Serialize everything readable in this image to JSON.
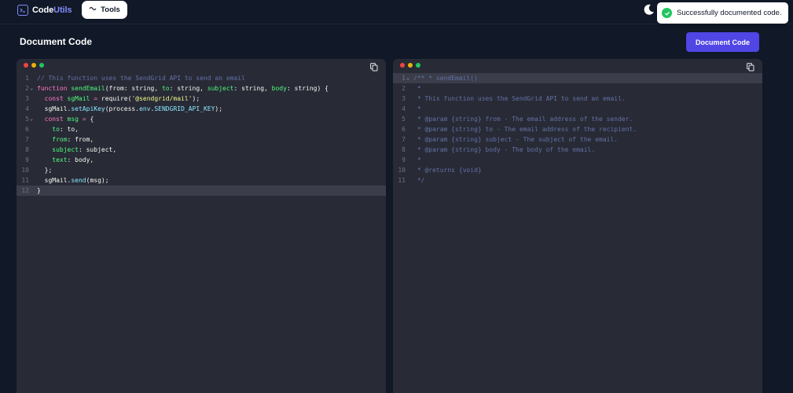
{
  "navbar": {
    "logo_code": "Code",
    "logo_utils": "Utils",
    "tools_label": "Tools"
  },
  "toast": {
    "message": "Successfully documented code."
  },
  "header": {
    "title": "Document Code",
    "action_label": "Document Code"
  },
  "colors": {
    "background": "#111827",
    "accent": "#4f46e5",
    "editor_bg": "#282a36",
    "success": "#22c55e"
  },
  "icons": [
    "logo-icon",
    "tools-icon",
    "moon-icon",
    "check-icon",
    "copy-icon"
  ],
  "input_editor": {
    "active_line": 12,
    "lines": [
      {
        "n": "1",
        "fold": false,
        "tokens": [
          {
            "t": "// This function uses the SendGrid API to send an email",
            "c": "t-comment"
          }
        ]
      },
      {
        "n": "2",
        "fold": true,
        "tokens": [
          {
            "t": "function",
            "c": "t-kw"
          },
          {
            "t": " ",
            "c": "t-plain"
          },
          {
            "t": "sendEmail",
            "c": "t-fn"
          },
          {
            "t": "(from: string, ",
            "c": "t-plain"
          },
          {
            "t": "to",
            "c": "t-fn"
          },
          {
            "t": ": string, ",
            "c": "t-plain"
          },
          {
            "t": "subject",
            "c": "t-fn"
          },
          {
            "t": ": string, ",
            "c": "t-plain"
          },
          {
            "t": "body",
            "c": "t-fn"
          },
          {
            "t": ": string) {",
            "c": "t-plain"
          }
        ]
      },
      {
        "n": "3",
        "fold": false,
        "tokens": [
          {
            "t": "  const",
            "c": "t-kw"
          },
          {
            "t": " ",
            "c": "t-plain"
          },
          {
            "t": "sgMail",
            "c": "t-fn"
          },
          {
            "t": " = ",
            "c": "t-kw"
          },
          {
            "t": "require",
            "c": "t-plain"
          },
          {
            "t": "(",
            "c": "t-plain"
          },
          {
            "t": "'@sendgrid/mail'",
            "c": "t-str"
          },
          {
            "t": ");",
            "c": "t-plain"
          }
        ]
      },
      {
        "n": "4",
        "fold": false,
        "tokens": [
          {
            "t": "  sgMail.",
            "c": "t-plain"
          },
          {
            "t": "setApiKey",
            "c": "t-prop"
          },
          {
            "t": "(process.",
            "c": "t-plain"
          },
          {
            "t": "env",
            "c": "t-prop"
          },
          {
            "t": ".",
            "c": "t-plain"
          },
          {
            "t": "SENDGRID_API_KEY",
            "c": "t-prop"
          },
          {
            "t": ");",
            "c": "t-plain"
          }
        ]
      },
      {
        "n": "5",
        "fold": true,
        "tokens": [
          {
            "t": "  const",
            "c": "t-kw"
          },
          {
            "t": " ",
            "c": "t-plain"
          },
          {
            "t": "msg",
            "c": "t-fn"
          },
          {
            "t": " = ",
            "c": "t-kw"
          },
          {
            "t": "{",
            "c": "t-plain"
          }
        ]
      },
      {
        "n": "6",
        "fold": false,
        "tokens": [
          {
            "t": "    to",
            "c": "t-fn"
          },
          {
            "t": ": to,",
            "c": "t-plain"
          }
        ]
      },
      {
        "n": "7",
        "fold": false,
        "tokens": [
          {
            "t": "    from",
            "c": "t-fn"
          },
          {
            "t": ": from,",
            "c": "t-plain"
          }
        ]
      },
      {
        "n": "8",
        "fold": false,
        "tokens": [
          {
            "t": "    subject",
            "c": "t-fn"
          },
          {
            "t": ": subject,",
            "c": "t-plain"
          }
        ]
      },
      {
        "n": "9",
        "fold": false,
        "tokens": [
          {
            "t": "    text",
            "c": "t-fn"
          },
          {
            "t": ": body,",
            "c": "t-plain"
          }
        ]
      },
      {
        "n": "10",
        "fold": false,
        "tokens": [
          {
            "t": "  };",
            "c": "t-plain"
          }
        ]
      },
      {
        "n": "11",
        "fold": false,
        "tokens": [
          {
            "t": "  sgMail.",
            "c": "t-plain"
          },
          {
            "t": "send",
            "c": "t-prop"
          },
          {
            "t": "(msg);",
            "c": "t-plain"
          }
        ]
      },
      {
        "n": "12",
        "fold": false,
        "tokens": [
          {
            "t": "}",
            "c": "t-plain"
          }
        ]
      }
    ]
  },
  "output_editor": {
    "active_line": 1,
    "lines": [
      {
        "n": "1",
        "fold": true,
        "tokens": [
          {
            "t": "/** * sendEmail()",
            "c": "t-comment"
          }
        ]
      },
      {
        "n": "2",
        "fold": false,
        "tokens": [
          {
            "t": " *",
            "c": "t-comment"
          }
        ]
      },
      {
        "n": "3",
        "fold": false,
        "tokens": [
          {
            "t": " * This function uses the SendGrid API to send an email.",
            "c": "t-comment"
          }
        ]
      },
      {
        "n": "4",
        "fold": false,
        "tokens": [
          {
            "t": " *",
            "c": "t-comment"
          }
        ]
      },
      {
        "n": "5",
        "fold": false,
        "tokens": [
          {
            "t": " * @param {string} from - The email address of the sender.",
            "c": "t-comment"
          }
        ]
      },
      {
        "n": "6",
        "fold": false,
        "tokens": [
          {
            "t": " * @param {string} to - The email address of the recipient.",
            "c": "t-comment"
          }
        ]
      },
      {
        "n": "7",
        "fold": false,
        "tokens": [
          {
            "t": " * @param {string} subject - The subject of the email.",
            "c": "t-comment"
          }
        ]
      },
      {
        "n": "8",
        "fold": false,
        "tokens": [
          {
            "t": " * @param {string} body - The body of the email.",
            "c": "t-comment"
          }
        ]
      },
      {
        "n": "9",
        "fold": false,
        "tokens": [
          {
            "t": " *",
            "c": "t-comment"
          }
        ]
      },
      {
        "n": "10",
        "fold": false,
        "tokens": [
          {
            "t": " * @returns {void}",
            "c": "t-comment"
          }
        ]
      },
      {
        "n": "11",
        "fold": false,
        "tokens": [
          {
            "t": " */",
            "c": "t-comment"
          }
        ]
      }
    ]
  }
}
